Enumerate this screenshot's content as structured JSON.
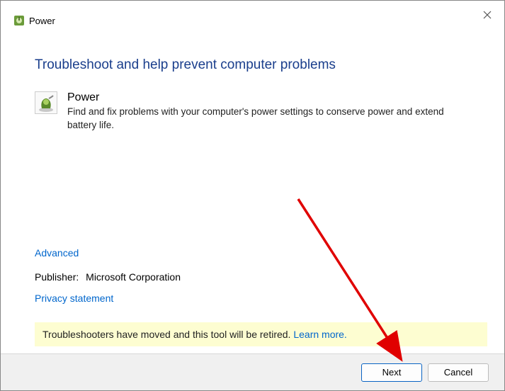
{
  "window": {
    "title": "Power"
  },
  "heading": "Troubleshoot and help prevent computer problems",
  "tool": {
    "title": "Power",
    "description": "Find and fix problems with your computer's power settings to conserve power and extend battery life."
  },
  "links": {
    "advanced": "Advanced",
    "privacy": "Privacy statement"
  },
  "publisher": {
    "label": "Publisher:",
    "value": "Microsoft Corporation"
  },
  "banner": {
    "message": "Troubleshooters have moved and this tool will be retired. ",
    "learn_more": "Learn more."
  },
  "buttons": {
    "next": "Next",
    "cancel": "Cancel"
  }
}
